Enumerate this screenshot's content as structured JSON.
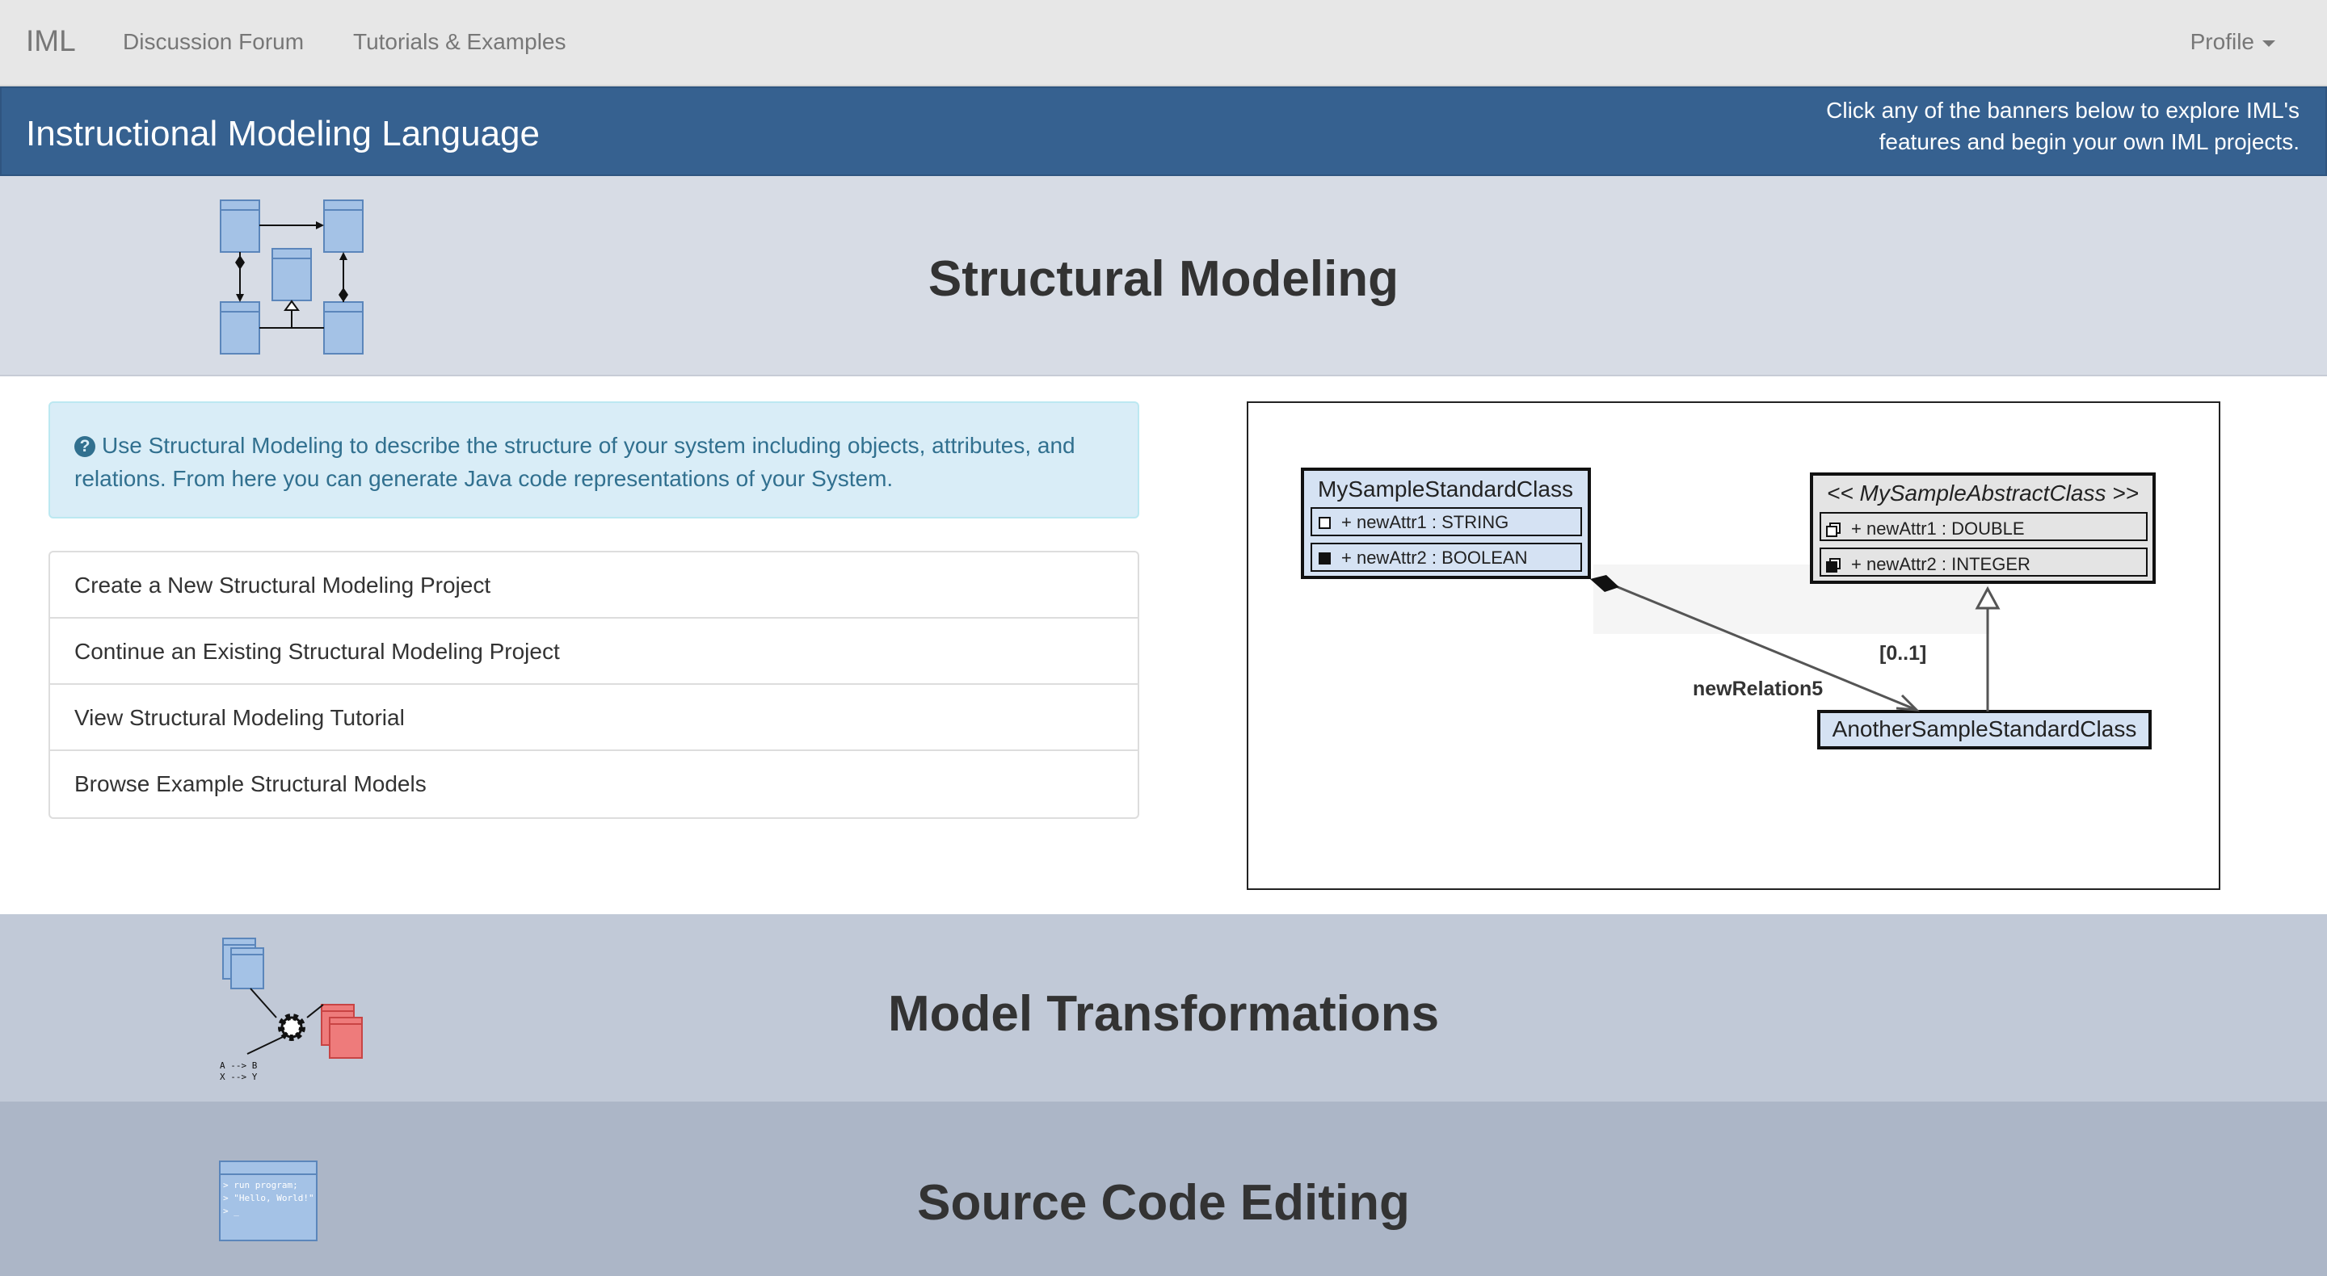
{
  "navbar": {
    "brand": "IML",
    "links": [
      "Discussion Forum",
      "Tutorials & Examples"
    ],
    "profile": "Profile"
  },
  "header": {
    "title": "Instructional Modeling Language",
    "note_line1": "Click any of the banners below to explore IML's",
    "note_line2": "features and begin your own IML projects."
  },
  "banners": {
    "structural": "Structural Modeling",
    "transform": "Model Transformations",
    "source": "Source Code Editing"
  },
  "info": {
    "line1": "Use Structural Modeling to describe the structure of your system including objects, attributes, and",
    "line2": "relations. From here you can generate Java code representations of your System."
  },
  "actions": [
    "Create a New Structural Modeling Project",
    "Continue an Existing Structural Modeling Project",
    "View Structural Modeling Tutorial",
    "Browse Example Structural Models"
  ],
  "diagram": {
    "class1": "MySampleStandardClass",
    "class1_attr1": "+ newAttr1 : STRING",
    "class1_attr2": "+ newAttr2 : BOOLEAN",
    "class2": "<< MySampleAbstractClass >>",
    "class2_attr1": "+ newAttr1 : DOUBLE",
    "class2_attr2": "+ newAttr2 : INTEGER",
    "class3": "AnotherSampleStandardClass",
    "relation": "newRelation5",
    "multiplicity": "[0..1]"
  },
  "code_icon": {
    "line1": "> run program;",
    "line2": "> \"Hello, World!\"",
    "line3": "> _"
  },
  "transform_icon": {
    "line1": "A --> B",
    "line2": "X --> Y"
  },
  "colors": {
    "navbar_bg": "#e7e7e7",
    "header_bg": "#366190",
    "banner1_bg": "#d7dce5",
    "banner2_bg": "#c1c9d7",
    "banner3_bg": "#acb6c7",
    "info_bg": "#d9edf7",
    "info_text": "#31708f",
    "class_fill": "#a4c2e6",
    "output_fill": "#ee7b7b"
  }
}
